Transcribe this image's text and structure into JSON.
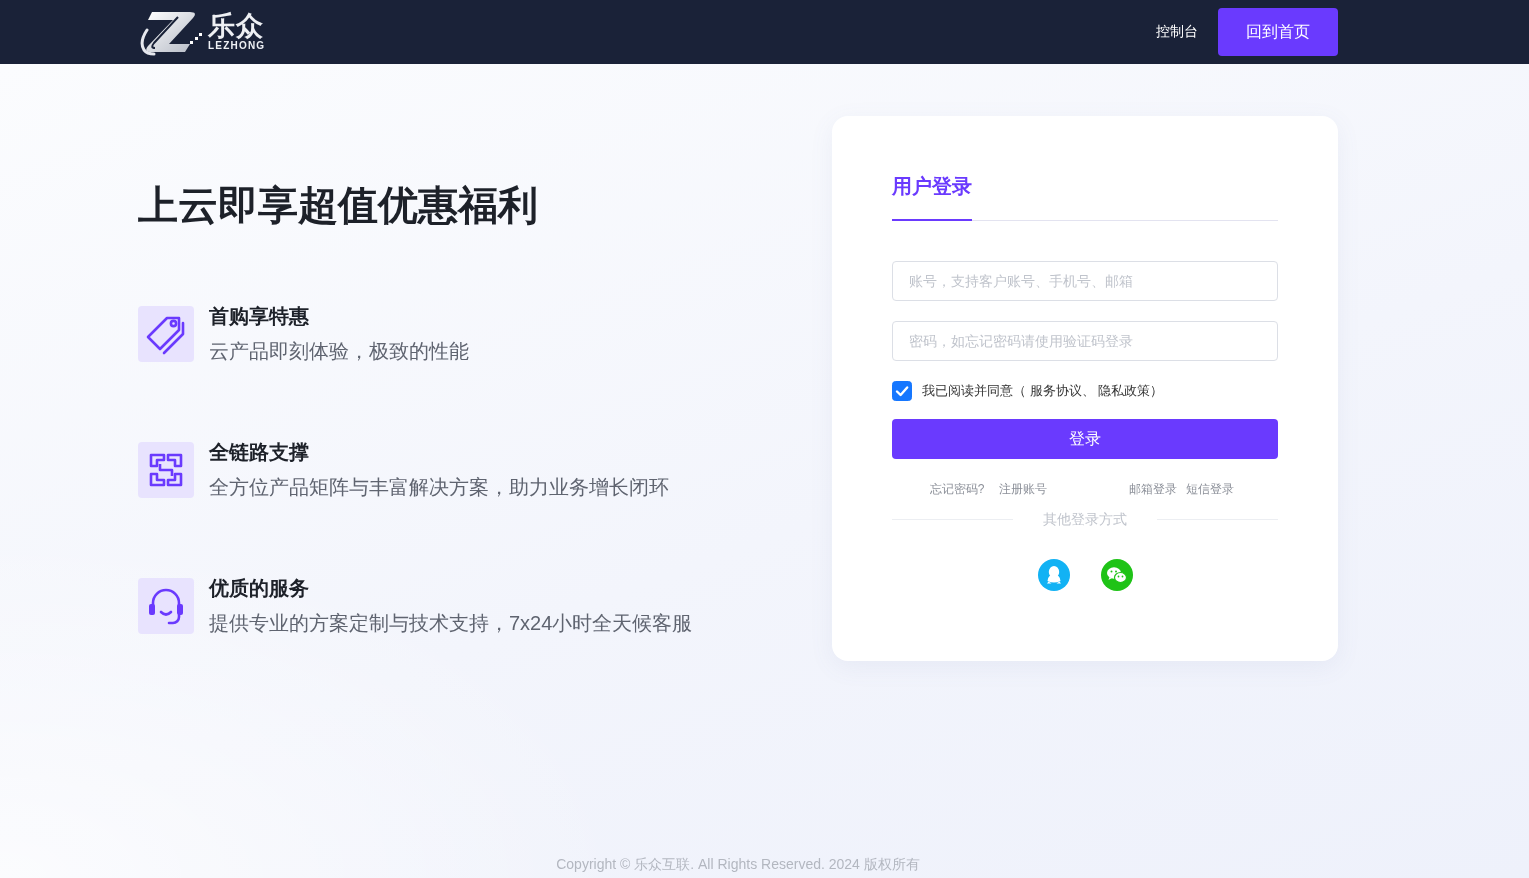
{
  "header": {
    "logo": {
      "name": "乐众",
      "subtitle": "LEZHONG"
    },
    "nav_links": [
      "控制台"
    ],
    "home_button": "回到首页"
  },
  "hero": {
    "title": "上云即享超值优惠福利",
    "features": [
      {
        "kind": "tag",
        "title": "首购享特惠",
        "description": "云产品即刻体验，极致的性能"
      },
      {
        "kind": "brackets",
        "title": "全链路支撑",
        "description": "全方位产品矩阵与丰富解决方案，助力业务增长闭环"
      },
      {
        "kind": "headset",
        "title": "优质的服务",
        "description": "提供专业的方案定制与技术支持，7x24小时全天候客服"
      }
    ]
  },
  "login": {
    "tabs": [
      {
        "label": "用户登录",
        "selected": true
      }
    ],
    "fields": [
      {
        "placeholder": "账号，支持客户账号、手机号、邮箱"
      },
      {
        "placeholder": "密码，如忘记密码请使用验证码登录"
      }
    ],
    "agreement": {
      "checked": true,
      "text": "我已阅读并同意（ 服务协议、 隐私政策）"
    },
    "submit": "登录",
    "links_left": [
      "忘记密码?",
      "注册账号"
    ],
    "links_right": [
      "邮箱登录",
      "短信登录"
    ],
    "other_methods": {
      "label": "其他登录方式",
      "providers": [
        {
          "kind": "qq"
        },
        {
          "kind": "wechat"
        }
      ]
    }
  },
  "footer": "Copyright © 乐众互联. All Rights Reserved. 2024 版权所有"
}
